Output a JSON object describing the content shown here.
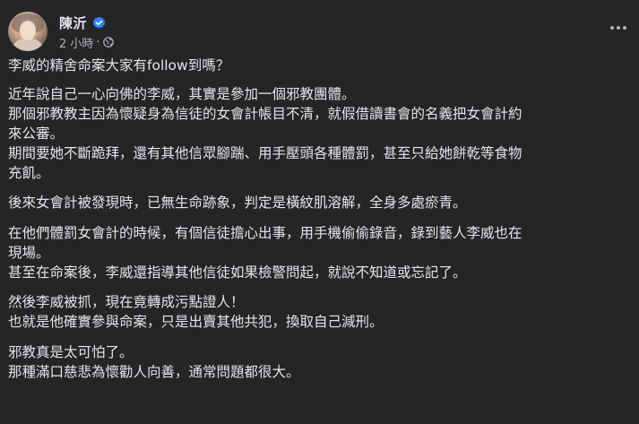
{
  "author": {
    "name": "陳沂",
    "verified": true,
    "time": "2 小時",
    "dot": "·",
    "privacy_icon": "globe-icon"
  },
  "more_icon": "more-options-icon",
  "post": {
    "paragraphs": [
      {
        "lines": [
          "李威的精舍命案大家有follow到嗎？"
        ]
      },
      {
        "lines": [
          "近年說自己一心向佛的李威，其實是參加一個邪教團體。",
          "那個邪教教主因為懷疑身為信徒的女會計帳目不清，就假借讀書會的名義把女會計約",
          "來公審。",
          "期間要她不斷跪拜，還有其他信眾腳踹、用手壓頭各種體罰，甚至只給她餅乾等食物",
          "充飢。"
        ]
      },
      {
        "lines": [
          "後來女會計被發現時，已無生命跡象，判定是橫紋肌溶解，全身多處瘀青。"
        ]
      },
      {
        "lines": [
          "在他們體罰女會計的時候，有個信徒擔心出事，用手機偷偷錄音，錄到藝人李威也在",
          "現場。",
          "甚至在命案後，李威還指導其他信徒如果檢警問起，就說不知道或忘記了。"
        ]
      },
      {
        "lines": [
          "然後李威被抓，現在竟轉成污點證人！",
          "也就是他確實參與命案，只是出賣其他共犯，換取自己減刑。"
        ]
      },
      {
        "lines": [
          "邪教真是太可怕了。",
          "那種滿口慈悲為懷勸人向善，通常問題都很大。"
        ]
      }
    ]
  },
  "colors": {
    "background": "#242526",
    "text": "#e4e6eb",
    "secondary": "#b0b3b8",
    "verified": "#2d88ff"
  }
}
